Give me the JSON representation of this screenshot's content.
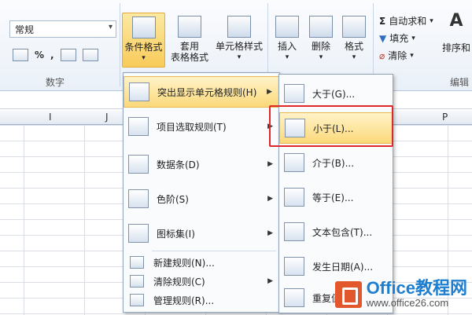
{
  "ribbon": {
    "number_format": "常规",
    "number_group": "数字",
    "percent": "%",
    "comma": ",",
    "inc_decimal": ".00\n→.0",
    "dec_decimal": ".00\n.0",
    "cond_format": "条件格式",
    "table_format_1": "套用",
    "table_format_2": "表格格式",
    "cell_style": "单元格样式",
    "insert": "插入",
    "delete": "删除",
    "format": "格式",
    "autosum": "自动求和",
    "fill": "填充",
    "clear": "清除",
    "sort": "排序和",
    "edit_group": "编辑"
  },
  "columns": [
    "I",
    "J",
    "P"
  ],
  "menu": {
    "items": [
      {
        "label": "突出显示单元格规则(H)"
      },
      {
        "label": "项目选取规则(T)"
      },
      {
        "label": "数据条(D)"
      },
      {
        "label": "色阶(S)"
      },
      {
        "label": "图标集(I)"
      },
      {
        "label": "新建规则(N)..."
      },
      {
        "label": "清除规则(C)"
      },
      {
        "label": "管理规则(R)..."
      }
    ]
  },
  "submenu": {
    "items": [
      {
        "label": "大于(G)..."
      },
      {
        "label": "小于(L)..."
      },
      {
        "label": "介于(B)..."
      },
      {
        "label": "等于(E)..."
      },
      {
        "label": "文本包含(T)..."
      },
      {
        "label": "发生日期(A)..."
      },
      {
        "label": "重复值"
      }
    ]
  },
  "watermark": {
    "brand": "Office教程网",
    "url": "www.office26.com"
  },
  "colors": {
    "highlight": "#fbd97a",
    "callout": "#e0282a",
    "brand": "#1e7fd0",
    "logo": "#e2572b"
  }
}
